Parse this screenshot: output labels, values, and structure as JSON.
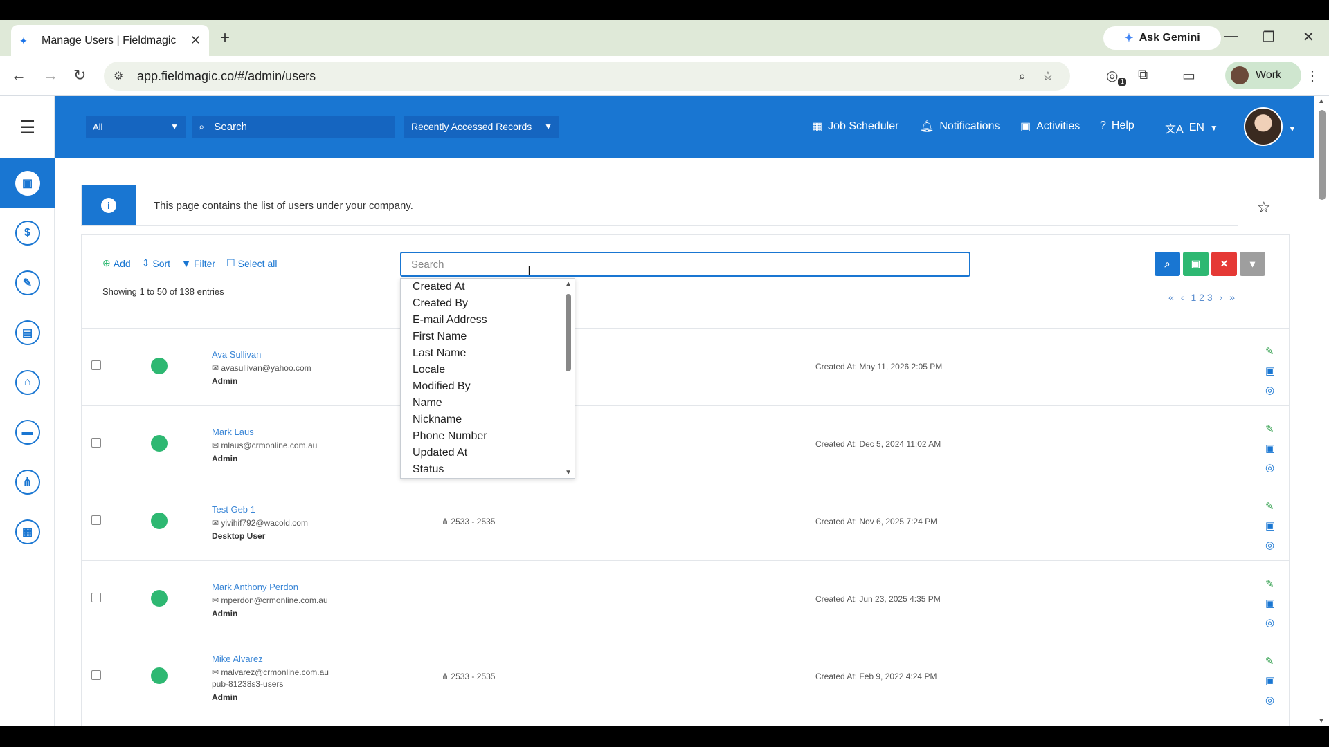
{
  "browser": {
    "tab_title": "Manage Users | Fieldmagic",
    "ask_gemini": "Ask Gemini",
    "url": "app.fieldmagic.co/#/admin/users",
    "profile_label": "Work",
    "extension_badge": "1"
  },
  "topnav": {
    "scope_value": "All",
    "search_placeholder": "Search",
    "recent_records": "Recently Accessed Records",
    "job_scheduler": "Job Scheduler",
    "notifications": "Notifications",
    "activities": "Activities",
    "help": "Help",
    "language": "EN"
  },
  "info": {
    "message": "This page contains the list of users under your company."
  },
  "toolbar": {
    "add": "Add",
    "sort": "Sort",
    "filter": "Filter",
    "select_all": "Select all",
    "showing": "Showing 1 to 50 of 138 entries",
    "search_placeholder": "Search"
  },
  "pager": {
    "pages": "1 2 3"
  },
  "dropdown_options": [
    "Created At",
    "Created By",
    "E-mail Address",
    "First Name",
    "Last Name",
    "Locale",
    "Modified By",
    "Name",
    "Nickname",
    "Phone Number",
    "Updated At",
    "Status"
  ],
  "users": [
    {
      "name": "Ava Sullivan",
      "email": "avasullivan@yahoo.com",
      "extra": "",
      "role": "Admin",
      "range": "",
      "created": "Created At: May 11, 2026 2:05 PM"
    },
    {
      "name": "Mark Laus",
      "email": "mlaus@crmonline.com.au",
      "extra": "",
      "role": "Admin",
      "range": "",
      "created": "Created At: Dec 5, 2024 11:02 AM"
    },
    {
      "name": "Test Geb 1",
      "email": "yivihif792@wacold.com",
      "extra": "",
      "role": "Desktop User",
      "range": "2533 - 2535",
      "created": "Created At: Nov 6, 2025 7:24 PM"
    },
    {
      "name": "Mark Anthony Perdon",
      "email": "mperdon@crmonline.com.au",
      "extra": "",
      "role": "Admin",
      "range": "",
      "created": "Created At: Jun 23, 2025 4:35 PM"
    },
    {
      "name": "Mike Alvarez",
      "email": "malvarez@crmonline.com.au",
      "extra": "pub-81238s3-users",
      "role": "Admin",
      "range": "2533 - 2535",
      "created": "Created At: Feb 9, 2022 4:24 PM"
    }
  ],
  "colors": {
    "brand": "#1976d2",
    "status_active": "#2eb872",
    "btn_search": "#1976d2",
    "btn_save": "#2eb872",
    "btn_clear": "#e53935",
    "btn_more": "#9e9e9e"
  }
}
